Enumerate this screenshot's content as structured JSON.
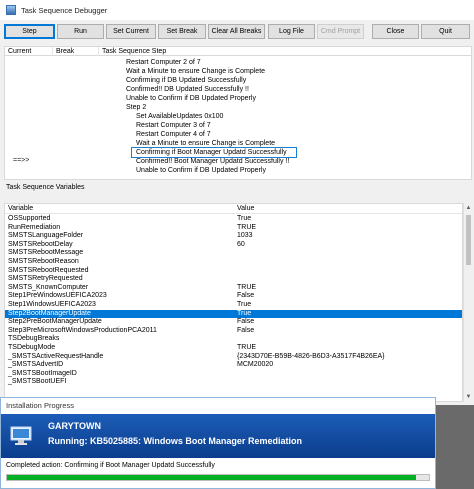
{
  "window": {
    "title": "Task Sequence Debugger"
  },
  "toolbar": {
    "step": "Step",
    "run": "Run",
    "set_current": "Set Current",
    "set_break": "Set Break",
    "clear_all_breaks": "Clear All Breaks",
    "log_file": "Log File",
    "cmd_prompt": "Cmd Prompt",
    "close": "Close",
    "quit": "Quit"
  },
  "step_columns": {
    "current": "Current",
    "break": "Break",
    "step": "Task Sequence Step"
  },
  "steps": [
    "Restart Computer 2 of 7",
    "Wait a Minute to ensure Change is Complete",
    "Confirming if DB Updated Successfully",
    "Confirmed!! DB Updated Successfully !!",
    "Unable to Confirm if DB Updated Properly",
    "Step 2",
    "Set AvailableUpdates 0x100",
    "Restart Computer 3 of 7",
    "Restart Computer 4 of 7",
    "Wait a Minute to ensure Change is Complete",
    "Confirming if Boot Manager Updatd Successfully",
    "Confirmed!! Boot Manager Updatd Successfully !!",
    "Unable to Confirm if DB Updated Properly"
  ],
  "current_marker": "==>>",
  "variables": {
    "label": "Task Sequence Variables",
    "col_variable": "Variable",
    "col_value": "Value",
    "rows": [
      {
        "name": "OSSupported",
        "value": "True"
      },
      {
        "name": "RunRemediation",
        "value": "TRUE"
      },
      {
        "name": "SMSTSLanguageFolder",
        "value": "1033"
      },
      {
        "name": "SMSTSRebootDelay",
        "value": "60"
      },
      {
        "name": "SMSTSRebootMessage",
        "value": ""
      },
      {
        "name": "SMSTSRebootReason",
        "value": ""
      },
      {
        "name": "SMSTSRebootRequested",
        "value": ""
      },
      {
        "name": "SMSTSRetryRequested",
        "value": ""
      },
      {
        "name": "SMSTS_KnownComputer",
        "value": "TRUE"
      },
      {
        "name": "Step1PreWindowsUEFICA2023",
        "value": "False"
      },
      {
        "name": "Step1WindowsUEFICA2023",
        "value": "True"
      },
      {
        "name": "Step2BootManagerUpdate",
        "value": "True"
      },
      {
        "name": "Step2PreBootManagerUpdate",
        "value": "False"
      },
      {
        "name": "Step3PreMicrosoftWindowsProductionPCA2011",
        "value": "False"
      },
      {
        "name": "TSDebugBreaks",
        "value": ""
      },
      {
        "name": "TSDebugMode",
        "value": "TRUE"
      },
      {
        "name": "_SMSTSActiveRequestHandle",
        "value": "{2343D70E-B59B-4826-B6D3-A3517F4B26EA}"
      },
      {
        "name": "_SMSTSAdvertID",
        "value": "MCM20020"
      },
      {
        "name": "_SMSTSBootImageID",
        "value": ""
      },
      {
        "name": "_SMSTSBootUEFI",
        "value": ""
      }
    ]
  },
  "progress": {
    "title": "Installation Progress",
    "org": "GARYTOWN",
    "running": "Running: KB5025885: Windows Boot Manager Remediation",
    "status": "Completed action: Confirming if Boot Manager Updatd Successfully",
    "fraction": 0.97
  },
  "colors": {
    "selection": "#0078d7",
    "banner": "#1c5db8",
    "progress_fill": "#06b025"
  }
}
